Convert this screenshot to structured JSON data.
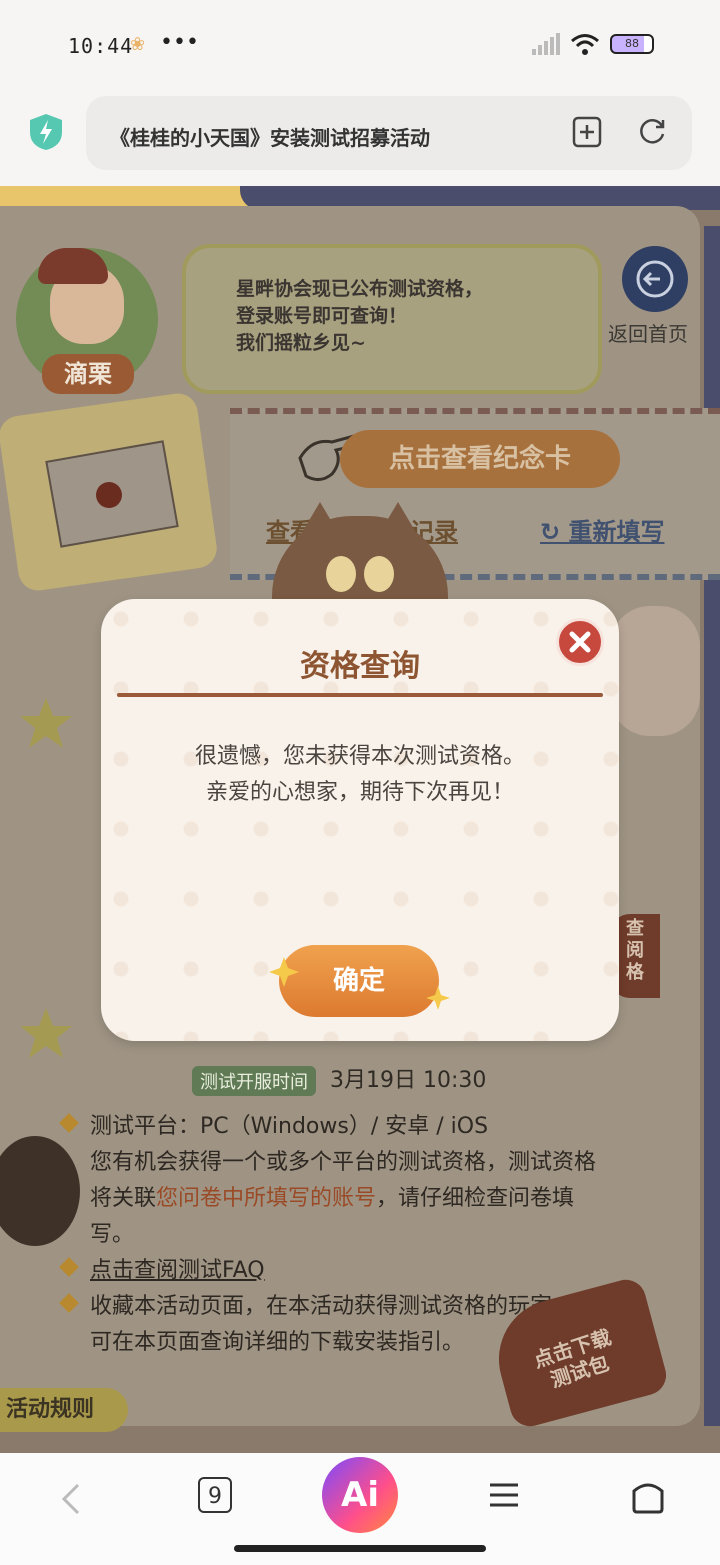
{
  "status": {
    "time": "10:44",
    "battery": "88",
    "network": "4G"
  },
  "browser": {
    "page_title": "《桂桂的小天国》安装测试招募活动",
    "tab_count": "9",
    "ai_label": "Ai"
  },
  "hero": {
    "avatar_name": "滴栗",
    "bubble_text": "星畔协会现已公布测试资格，\n登录账号即可查询！\n我们摇粒乡见~",
    "home_label": "返回首页"
  },
  "card": {
    "view_card_label": "点击查看纪念卡",
    "view_record_label": "查看问卷填写记录",
    "refill_label": "重新填写"
  },
  "info": {
    "tag_label": "测试开服时间",
    "open_date": "3月19日  10:30",
    "rules": [
      {
        "text": "测试平台：PC（Windows）/ 安卓 / iOS"
      },
      {
        "text": "您有机会获得一个或多个平台的测试资格，测试资格"
      },
      {
        "text_a": "将关联",
        "text_b": "您问卷中所填写的账号",
        "text_c": "，请仔细检查问卷填"
      },
      {
        "text": "写。"
      },
      {
        "text": "点击查阅测试FAQ"
      },
      {
        "text": "收藏本活动页面，在本活动获得测试资格的玩家，"
      },
      {
        "text": "可在本页面查询详细的下载安装指引。"
      }
    ],
    "download_label": "点击下载\n测试包",
    "rules_button": "活动规则",
    "side_button": "查\n阅\n格"
  },
  "modal": {
    "title": "资格查询",
    "message_line1": "很遗憾，您未获得本次测试资格。",
    "message_line2": "亲爱的心想家，期待下次再见！",
    "confirm_label": "确定"
  },
  "colors": {
    "modal_bg": "#f9f2ea",
    "title_color": "#8e5532",
    "close_red": "#c7493e",
    "confirm_orange": "#e8913f"
  }
}
